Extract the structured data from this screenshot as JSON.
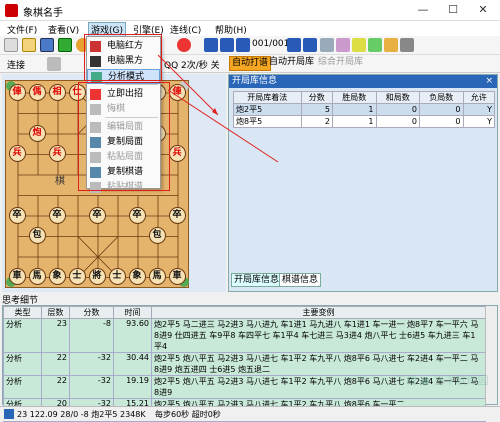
{
  "app": {
    "title": "象棋名手"
  },
  "window_controls": {
    "minimize": "—",
    "maximize": "☐",
    "close": "✕"
  },
  "menu": {
    "file": "文件(F)",
    "view": "查看(V)",
    "game": "游戏(G)",
    "engine": "引擎(E)",
    "connect": "连线(C)",
    "help": "帮助(H)"
  },
  "toolbar": {
    "page": "001/001",
    "connect_label": "连接",
    "speed": "QQ 2次/秒 关",
    "auto_play": "自动打谱",
    "auto_book": "自动开局库",
    "combined_book": "综合开局库"
  },
  "game_menu": {
    "items": [
      {
        "label": "电脑红方",
        "disabled": false
      },
      {
        "label": "电脑黑方",
        "disabled": false
      },
      {
        "label": "分析模式",
        "disabled": false
      },
      {
        "label": "立即出招",
        "disabled": false
      },
      {
        "label": "悔棋",
        "disabled": true
      },
      {
        "label": "编辑局面",
        "disabled": true
      },
      {
        "label": "复制局面",
        "disabled": false
      },
      {
        "label": "粘贴局面",
        "disabled": true
      },
      {
        "label": "复制棋谱",
        "disabled": false
      },
      {
        "label": "粘贴棋谱",
        "disabled": true
      }
    ]
  },
  "board": {
    "river_left": "棋",
    "river_right": "中",
    "top_row": [
      "俥",
      "傌",
      "相",
      "仕",
      "帥",
      "仕",
      "相",
      "傌",
      "俥"
    ],
    "red_cannons": [
      "炮",
      "炮"
    ],
    "red_pawns": [
      "兵",
      "兵",
      "兵",
      "兵",
      "兵"
    ],
    "black_pawns": [
      "卒",
      "卒",
      "卒",
      "卒",
      "卒"
    ],
    "black_cannons": [
      "包",
      "包"
    ],
    "bottom_row": [
      "車",
      "馬",
      "象",
      "士",
      "將",
      "士",
      "象",
      "馬",
      "車"
    ]
  },
  "opening_book": {
    "title": "开局库信息",
    "headers": [
      "开局库着法",
      "分数",
      "胜局数",
      "和局数",
      "负局数",
      "允许"
    ],
    "rows": [
      {
        "move": "炮2平5",
        "score": "5",
        "win": "1",
        "draw": "0",
        "loss": "0",
        "allow": "Y"
      },
      {
        "move": "炮8平5",
        "score": "2",
        "win": "1",
        "draw": "0",
        "loss": "0",
        "allow": "Y"
      }
    ],
    "tabs": [
      "开局库信息",
      "棋谱信息"
    ]
  },
  "thinking": {
    "title": "思考细节",
    "headers": [
      "类型",
      "层数",
      "分数",
      "时间",
      "主要变例"
    ],
    "rows": [
      {
        "type": "分析",
        "depth": "23",
        "score": "-8",
        "time": "93.60",
        "pv": "炮2平5 马二进三 马2进3 马八进九 车1进1 马九进八 车1进1 车一进一 炮8平7 车一平六 马8进9 仕四进五 车9平8 车四平七 车1平4 车七进三 马3进4 炮八平七 士6进5 车九进三 车1平4"
      },
      {
        "type": "分析",
        "depth": "22",
        "score": "-32",
        "time": "30.44",
        "pv": "炮2平5 炮八平五 马2进3 马八进七 车1平2 车九平八 炮8平6 马八进七 车2进4 车一平二 马8进9 炮五进四 士6进5 炮五退二"
      },
      {
        "type": "分析",
        "depth": "22",
        "score": "-32",
        "time": "19.19",
        "pv": "炮2平5 炮八平五 马2进3 马八进七 车1平2 车九平八 炮8平6 马八进七 车2进4 车一平二 马8进9"
      },
      {
        "type": "分析",
        "depth": "20",
        "score": "-32",
        "time": "15.21",
        "pv": "炮2平5 炮八平五 马2进3 马八进七 车1平2 车九平八 炮8平6 车一平二"
      }
    ]
  },
  "status": {
    "left": "23 122.09 28/0 -8 炮2平5 2348K",
    "right": "每步60秒 超时0秒"
  },
  "colors": {
    "accent_blue": "#2a66b8",
    "highlight_red": "#e02020",
    "board": "#e5b46c",
    "thinking_bg": "#c8e8d8"
  }
}
